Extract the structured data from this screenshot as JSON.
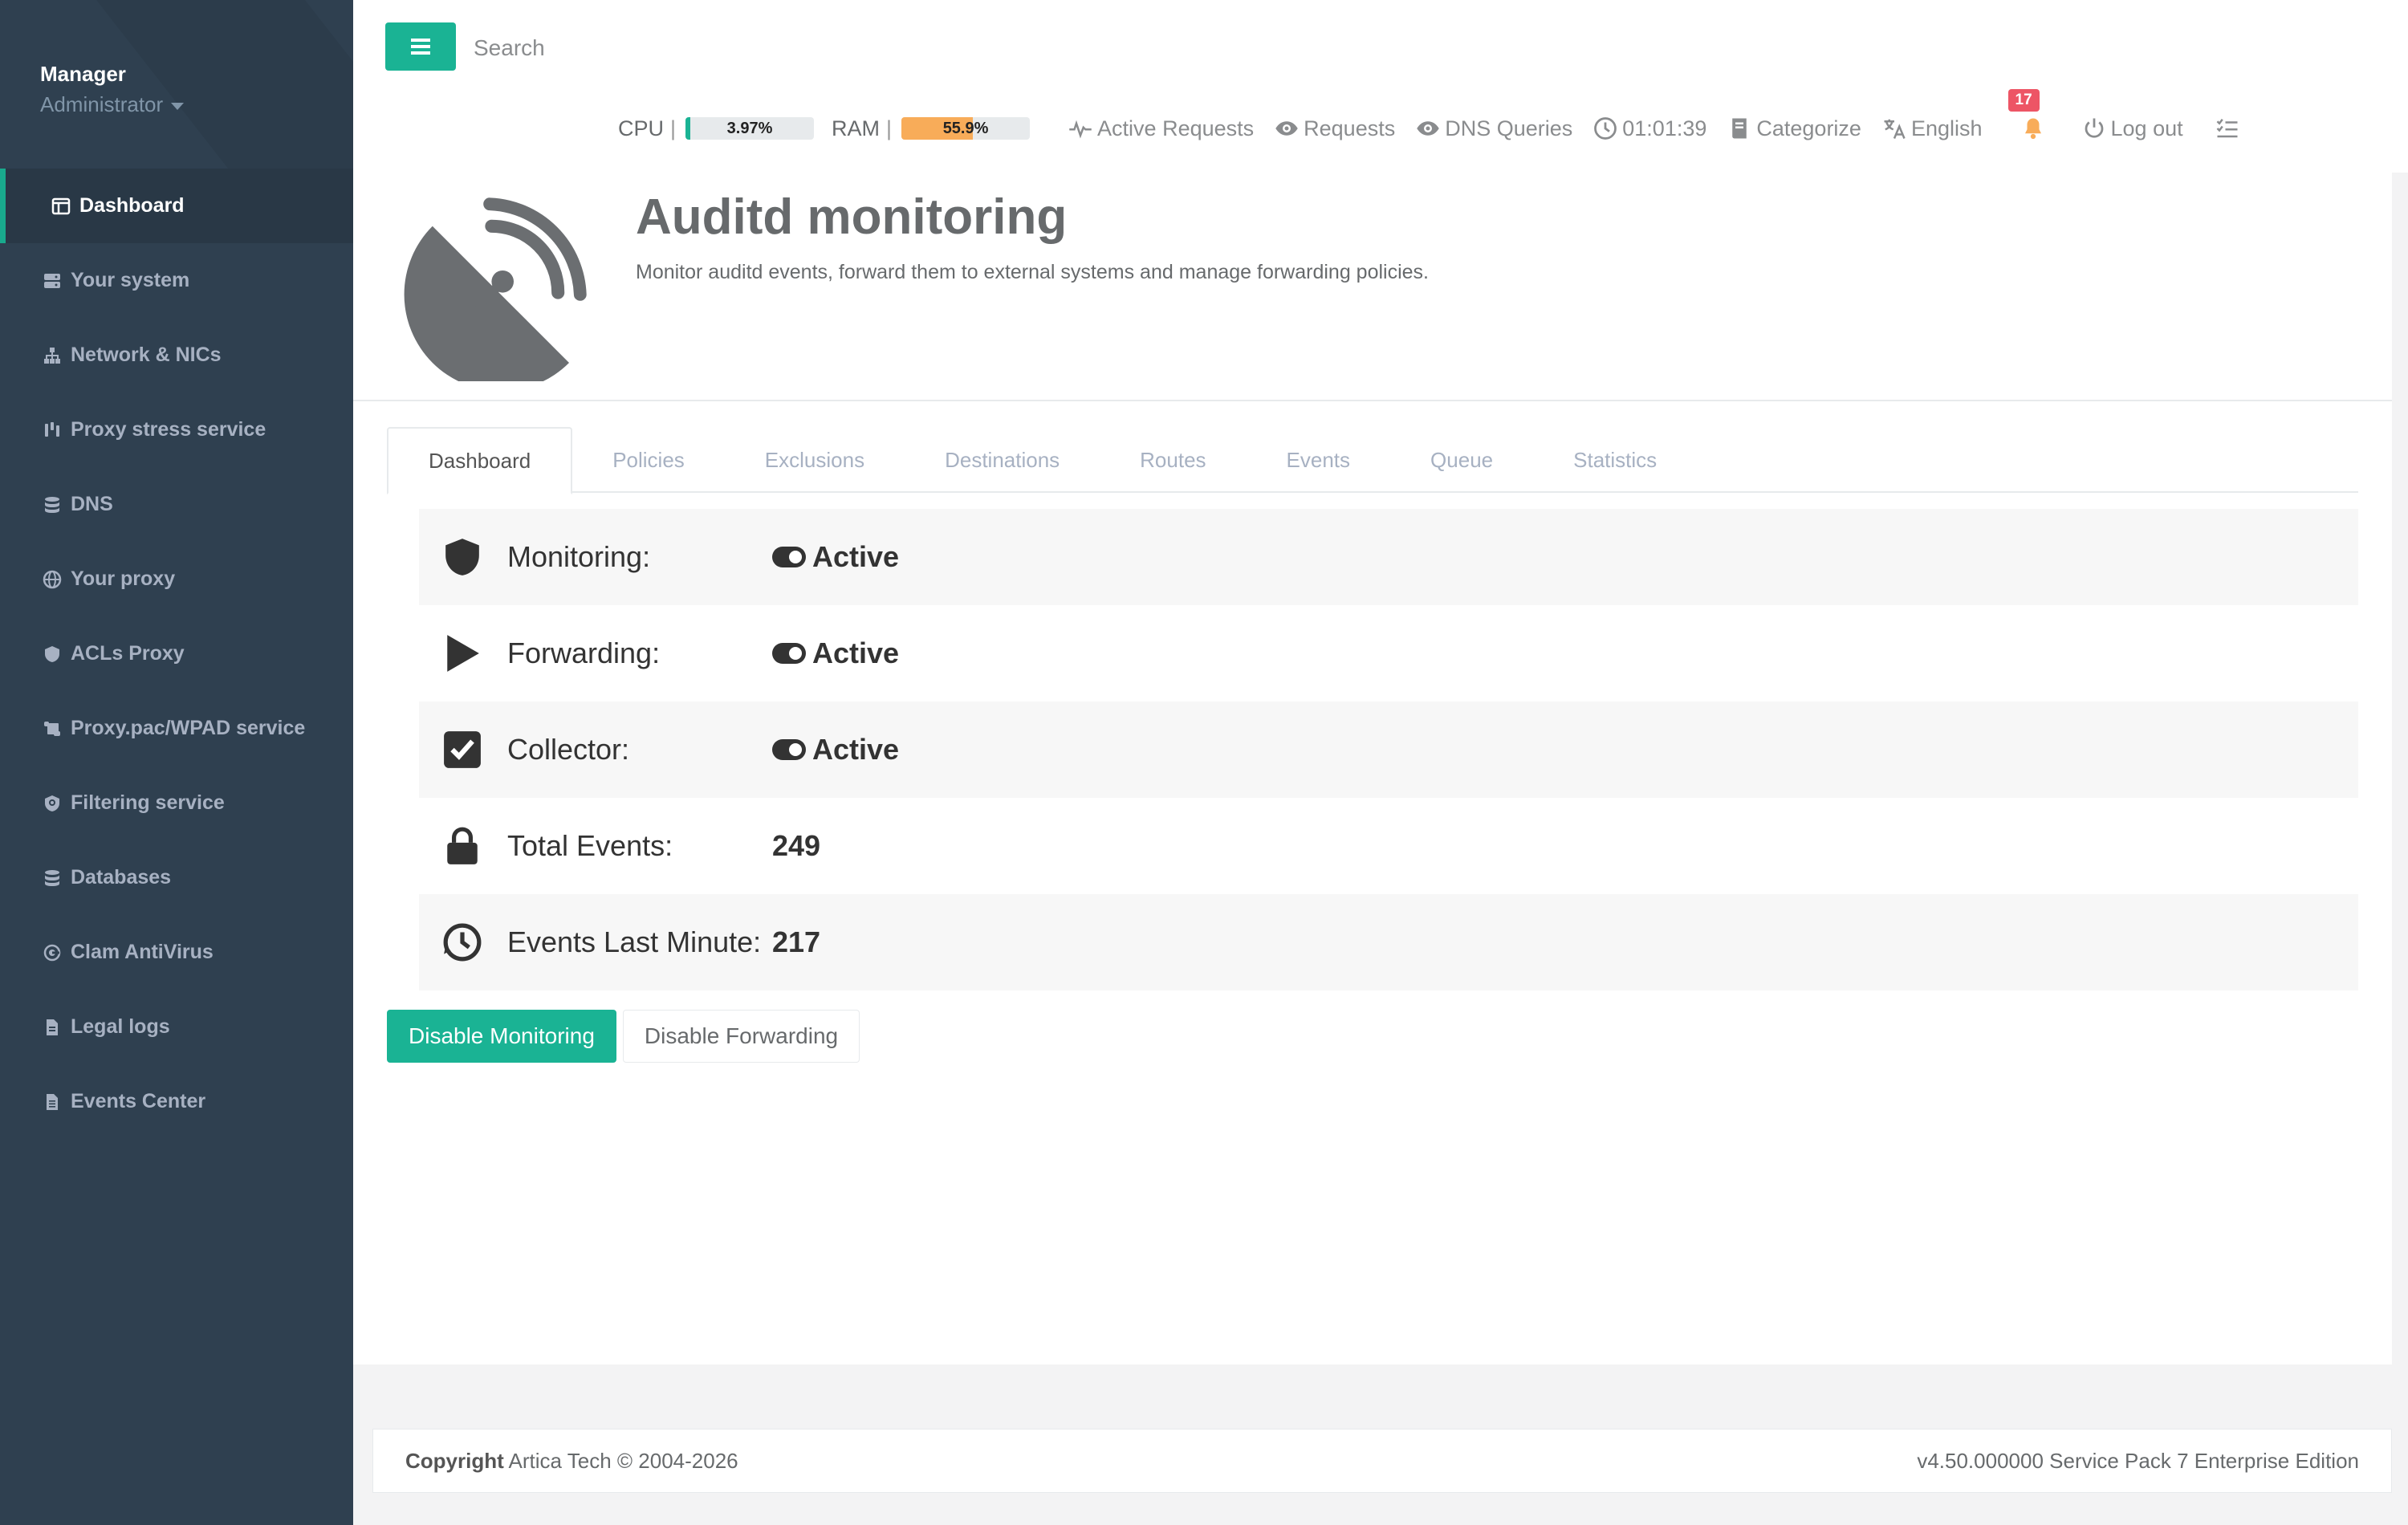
{
  "sidebar": {
    "profile": {
      "name": "Manager",
      "role": "Administrator"
    },
    "items": [
      {
        "label": "Dashboard",
        "icon": "dashboard-icon"
      },
      {
        "label": "Your system",
        "icon": "server-icon"
      },
      {
        "label": "Network & NICs",
        "icon": "network-icon"
      },
      {
        "label": "Proxy stress service",
        "icon": "stress-icon"
      },
      {
        "label": "DNS",
        "icon": "database-icon"
      },
      {
        "label": "Your proxy",
        "icon": "globe-icon"
      },
      {
        "label": "ACLs Proxy",
        "icon": "shield-icon"
      },
      {
        "label": "Proxy.pac/WPAD service",
        "icon": "scroll-icon"
      },
      {
        "label": "Filtering service",
        "icon": "filter-shield-icon"
      },
      {
        "label": "Databases",
        "icon": "database-icon"
      },
      {
        "label": "Clam AntiVirus",
        "icon": "virus-icon"
      },
      {
        "label": "Legal logs",
        "icon": "file-icon"
      },
      {
        "label": "Events Center",
        "icon": "file-lines-icon"
      }
    ]
  },
  "topbar": {
    "search_placeholder": "Search",
    "cpu": {
      "label": "CPU",
      "sep": "|",
      "value_text": "3.97%",
      "percent": 3.97,
      "color": "#1ab394"
    },
    "ram": {
      "label": "RAM",
      "sep": "|",
      "value_text": "55.9%",
      "percent": 55.9,
      "color": "#f8ac59"
    },
    "links": {
      "active_requests": "Active Requests",
      "requests": "Requests",
      "dns_queries": "DNS Queries",
      "clock": "01:01:39",
      "categorize": "Categorize",
      "language": "English",
      "logout": "Log out"
    },
    "notifications": "17"
  },
  "header": {
    "title": "Auditd monitoring",
    "subtitle": "Monitor auditd events, forward them to external systems and manage forwarding policies."
  },
  "tabs": [
    "Dashboard",
    "Policies",
    "Exclusions",
    "Destinations",
    "Routes",
    "Events",
    "Queue",
    "Statistics"
  ],
  "status": {
    "monitoring": {
      "label": "Monitoring:",
      "value": "Active"
    },
    "forwarding": {
      "label": "Forwarding:",
      "value": "Active"
    },
    "collector": {
      "label": "Collector:",
      "value": "Active"
    },
    "total_events": {
      "label": "Total Events:",
      "value": "249"
    },
    "events_last_minute": {
      "label": "Events Last Minute:",
      "value": "217"
    }
  },
  "buttons": {
    "disable_monitoring": "Disable Monitoring",
    "disable_forwarding": "Disable Forwarding"
  },
  "footer": {
    "copyright_label": "Copyright",
    "copyright_text": " Artica Tech © 2004-2026",
    "version": "v4.50.000000 Service Pack 7 Enterprise Edition"
  },
  "colors": {
    "accent": "#1ab394",
    "sidebar": "#2f4050",
    "badge": "#ed5565",
    "ram_bar": "#f8ac59"
  }
}
